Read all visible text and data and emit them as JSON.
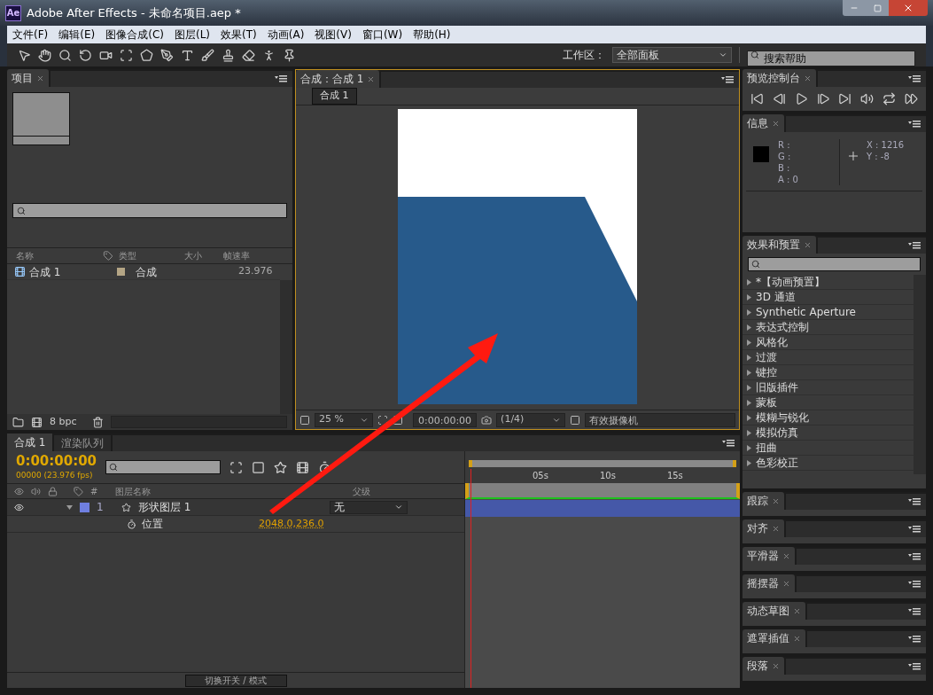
{
  "window": {
    "app_badge": "Ae",
    "title": "Adobe After Effects - 未命名项目.aep *"
  },
  "menu": [
    "文件(F)",
    "编辑(E)",
    "图像合成(C)",
    "图层(L)",
    "效果(T)",
    "动画(A)",
    "视图(V)",
    "窗口(W)",
    "帮助(H)"
  ],
  "toolbar": {
    "workspace_label": "工作区：",
    "workspace": "全部面板",
    "search_placeholder": "搜索帮助"
  },
  "project": {
    "tab": "项目",
    "columns": [
      "名称",
      "类型",
      "大小",
      "帧速率"
    ],
    "rows": [
      {
        "name": "合成 1",
        "type": "合成",
        "fps": "23.976",
        "color": "#b4a585"
      }
    ],
    "bpc": "8 bpc"
  },
  "composition": {
    "tab": "合成：合成 1",
    "breadcrumb": "合成 1",
    "zoom": "25 %",
    "timecode": "0:00:00:00",
    "resolution": "(1/4)",
    "camera": "有效摄像机"
  },
  "preview": {
    "tab": "预览控制台"
  },
  "info": {
    "tab": "信息",
    "channels": [
      "R :",
      "G :",
      "B :",
      "A : 0"
    ],
    "x": "X : 1216",
    "y": "Y : -8"
  },
  "effects": {
    "tab": "效果和预置",
    "items": [
      "*【动画预置】",
      "3D 通道",
      "Synthetic Aperture",
      "表达式控制",
      "风格化",
      "过渡",
      "键控",
      "旧版插件",
      "蒙板",
      "模糊与锐化",
      "模拟仿真",
      "扭曲",
      "色彩校正"
    ]
  },
  "side_panels": [
    "跟踪",
    "对齐",
    "平滑器",
    "摇摆器",
    "动态草图",
    "遮罩插值",
    "段落"
  ],
  "timeline": {
    "tabs": [
      {
        "label": "合成 1",
        "selected": true
      },
      {
        "label": "渲染队列",
        "selected": false
      }
    ],
    "timecode": "0:00:00:00",
    "frame": "00000 (23.976 fps)",
    "columns": [
      "#",
      "图层名称",
      "父级"
    ],
    "layers": [
      {
        "index": "1",
        "name": "形状图层 1",
        "color": "#6f7fe0",
        "expanded": true,
        "parent": "无",
        "property": {
          "name": "位置",
          "value": "2048.0,236.0"
        }
      }
    ],
    "ruler": [
      "05s",
      "10s",
      "15s"
    ],
    "switch_label": "切换开关 / 模式"
  }
}
